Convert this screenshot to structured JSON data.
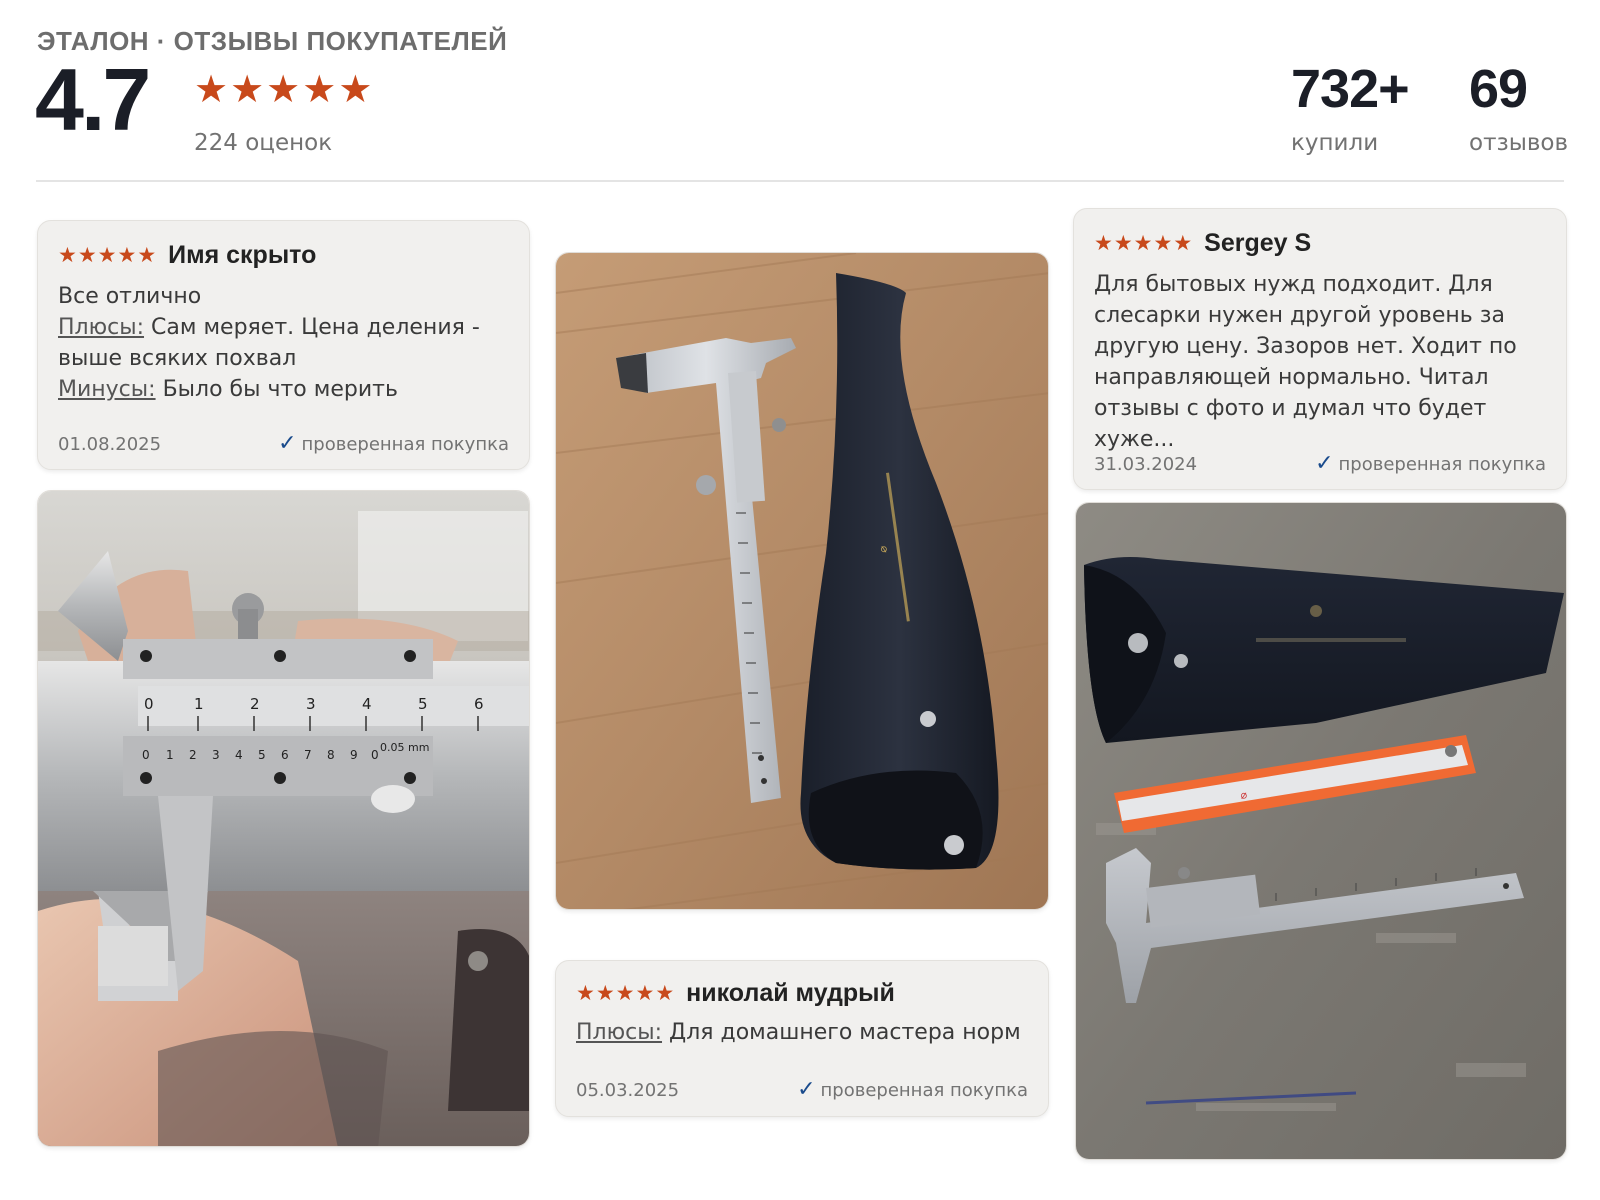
{
  "header": {
    "brand_title": "ЭТАЛОН · ОТЗЫВЫ ПОКУПАТЕЛЕЙ",
    "rating_value": "4.7",
    "rating_stars": 5,
    "ratings_count": "224 оценок",
    "bought_value": "732+",
    "bought_label": "купили",
    "reviews_value": "69",
    "reviews_label": "отзывов"
  },
  "reviews": [
    {
      "stars": 5,
      "author": "Имя скрыто",
      "text": "Все отлично",
      "pros_label": "Плюсы:",
      "pros": "Сам меряет. Цена деления - выше всяких похвал",
      "cons_label": "Минусы:",
      "cons": "Было бы что мерить",
      "date": "01.08.2025",
      "verified": "проверенная покупка"
    },
    {
      "stars": 5,
      "author": "николай мудрый",
      "pros_label": "Плюсы:",
      "pros": "Для домашнего мастера норм",
      "date": "05.03.2025",
      "verified": "проверенная покупка"
    },
    {
      "stars": 5,
      "author": "Sergey S",
      "text": "Для бытовых нужд подходит. Для слесарки нужен другой уровень за другую цену. Зазоров нет. Ходит по направляющей нормально. Читал отзывы с фото и думал что будет хуже...",
      "date": "31.03.2024",
      "verified": "проверенная покупка"
    }
  ],
  "photos": [
    {
      "subject": "caliper-in-hand-photo"
    },
    {
      "subject": "caliper-with-case-photo"
    },
    {
      "subject": "caliper-case-ruler-photo"
    }
  ],
  "scale_digits_top": [
    "0",
    "1",
    "2",
    "3",
    "4",
    "5",
    "6"
  ],
  "scale_digits_vernier": [
    "0",
    "1",
    "2",
    "3",
    "4",
    "5",
    "6",
    "7",
    "8",
    "9",
    "0"
  ],
  "vernier_unit": "0.05 mm",
  "colors": {
    "star": "#c8491b",
    "check": "#1a4b8c",
    "card_bg": "#f1f0ee",
    "rating_text": "#1b1e27"
  }
}
